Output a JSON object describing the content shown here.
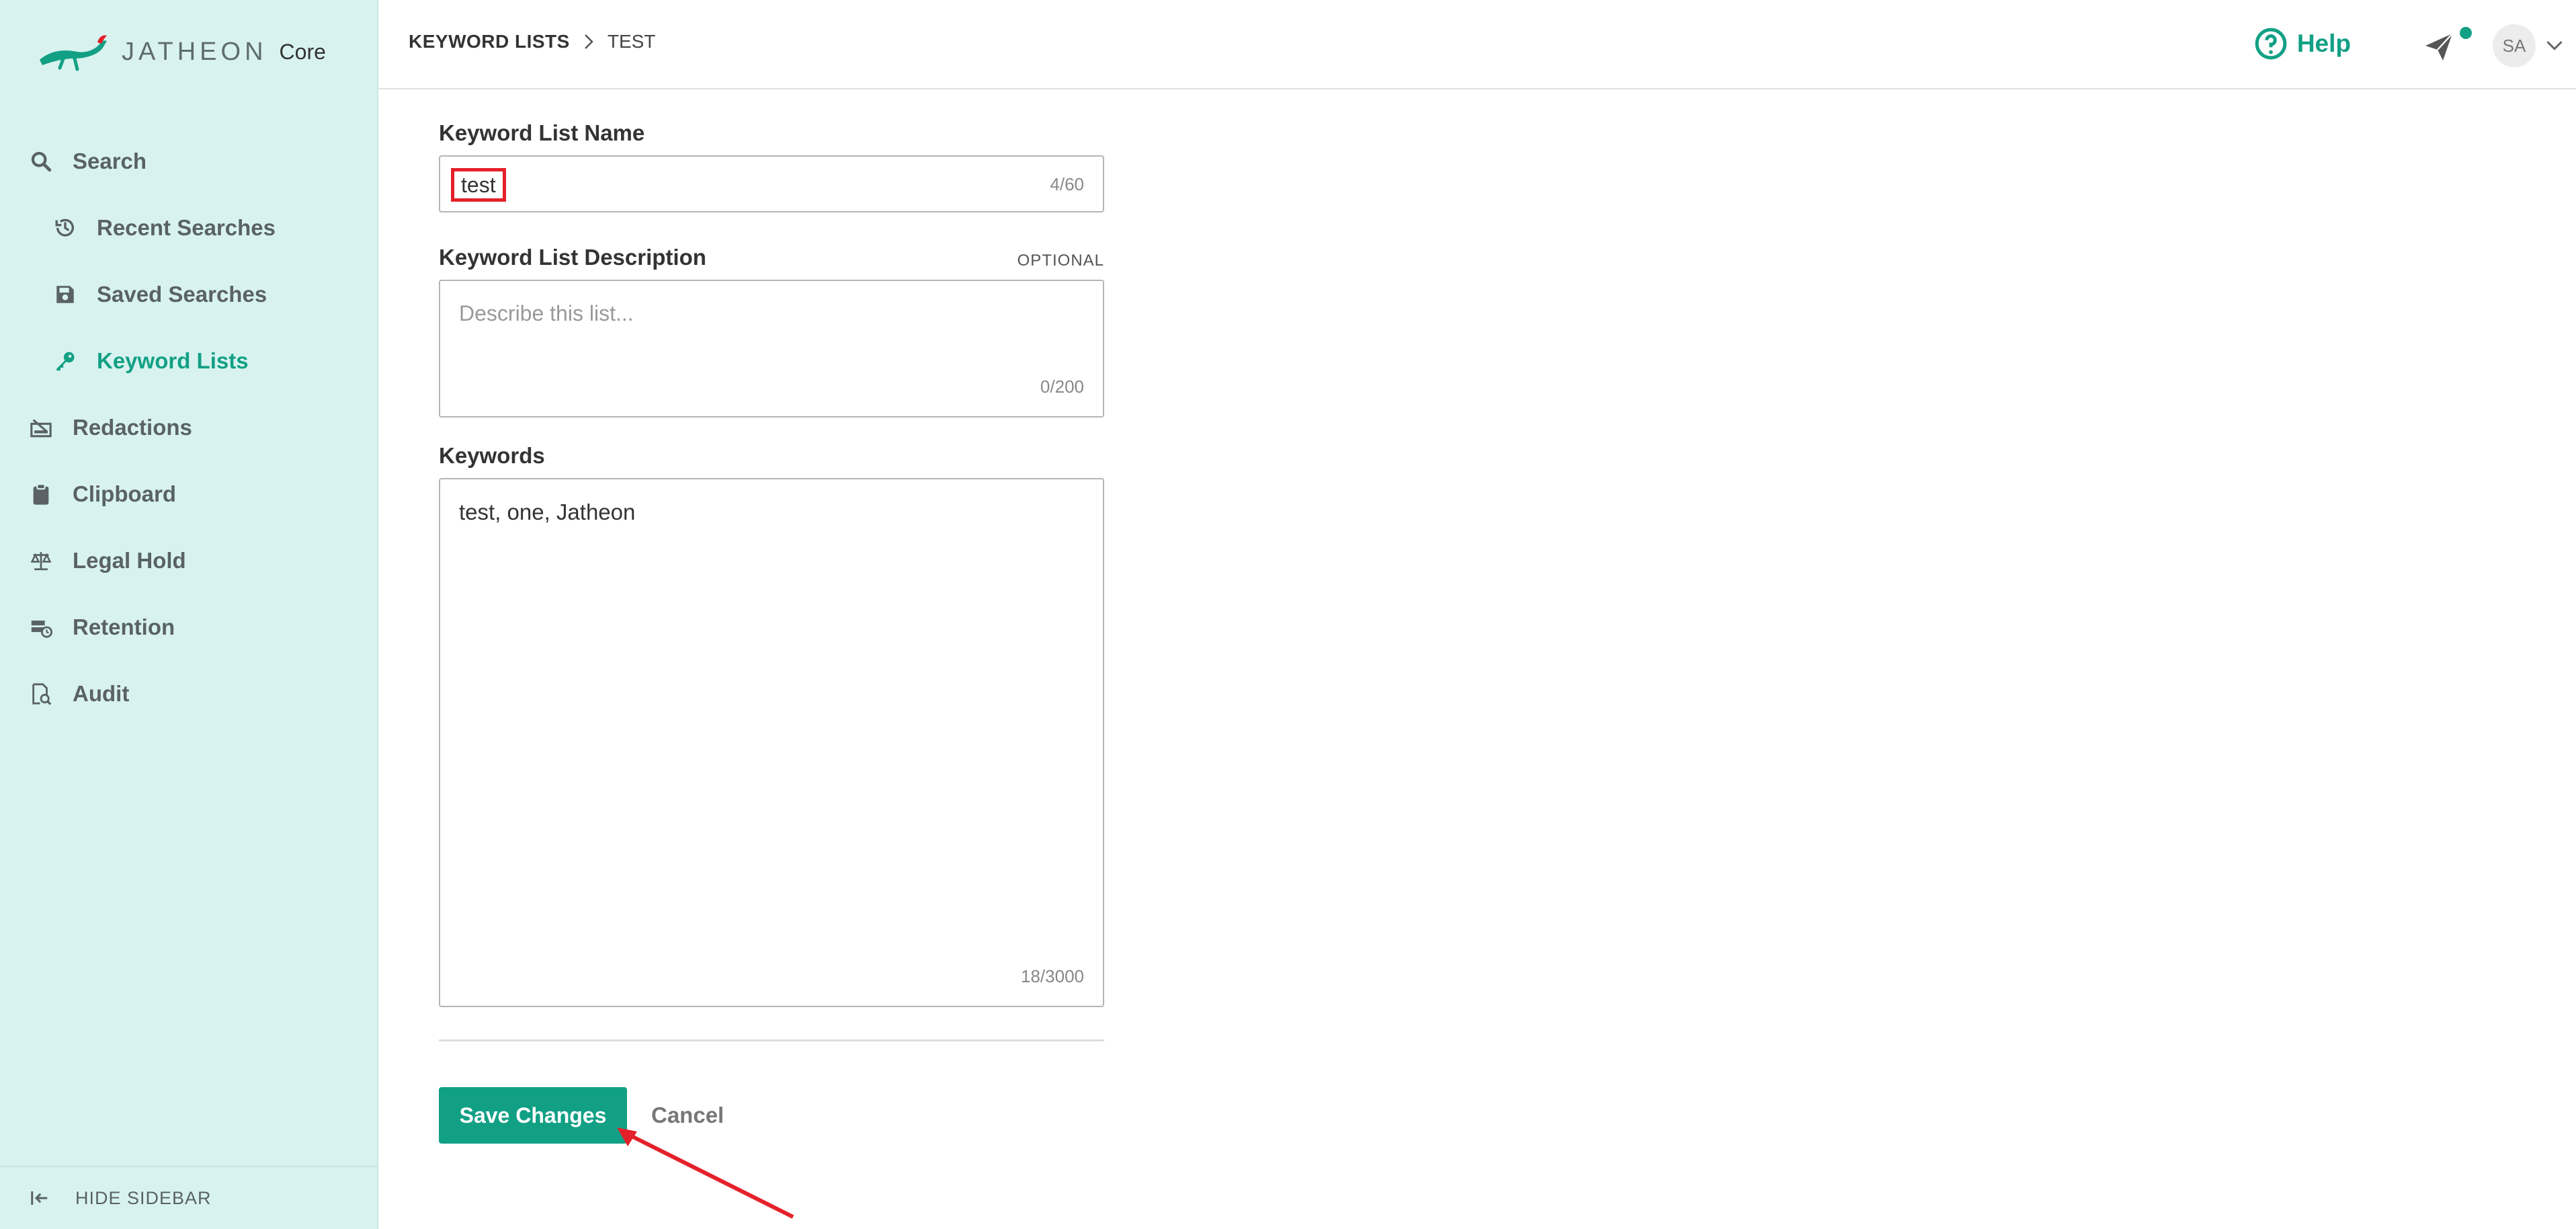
{
  "brand": {
    "name": "JATHEON",
    "product": "Core",
    "accent_color": "#12a085",
    "sidebar_bg": "#d8f3ef"
  },
  "sidebar": {
    "items": [
      {
        "label": "Search",
        "icon": "search-icon",
        "active": false,
        "sub": false
      },
      {
        "label": "Recent Searches",
        "icon": "history-icon",
        "active": false,
        "sub": true
      },
      {
        "label": "Saved Searches",
        "icon": "save-icon",
        "active": false,
        "sub": true
      },
      {
        "label": "Keyword Lists",
        "icon": "key-icon",
        "active": true,
        "sub": true
      },
      {
        "label": "Redactions",
        "icon": "redaction-icon",
        "active": false,
        "sub": false
      },
      {
        "label": "Clipboard",
        "icon": "clipboard-icon",
        "active": false,
        "sub": false
      },
      {
        "label": "Legal Hold",
        "icon": "scale-icon",
        "active": false,
        "sub": false
      },
      {
        "label": "Retention",
        "icon": "retention-icon",
        "active": false,
        "sub": false
      },
      {
        "label": "Audit",
        "icon": "audit-icon",
        "active": false,
        "sub": false
      }
    ],
    "hide_label": "HIDE SIDEBAR"
  },
  "header": {
    "breadcrumb_root": "KEYWORD LISTS",
    "breadcrumb_current": "TEST",
    "help_label": "Help",
    "avatar_initials": "SA"
  },
  "form": {
    "name_label": "Keyword List Name",
    "name_value": "test",
    "name_counter": "4/60",
    "description_label": "Keyword List Description",
    "description_optional": "OPTIONAL",
    "description_placeholder": "Describe this list...",
    "description_counter": "0/200",
    "keywords_label": "Keywords",
    "keywords_value": "test, one, Jatheon",
    "keywords_counter": "18/3000",
    "save_label": "Save Changes",
    "cancel_label": "Cancel"
  }
}
